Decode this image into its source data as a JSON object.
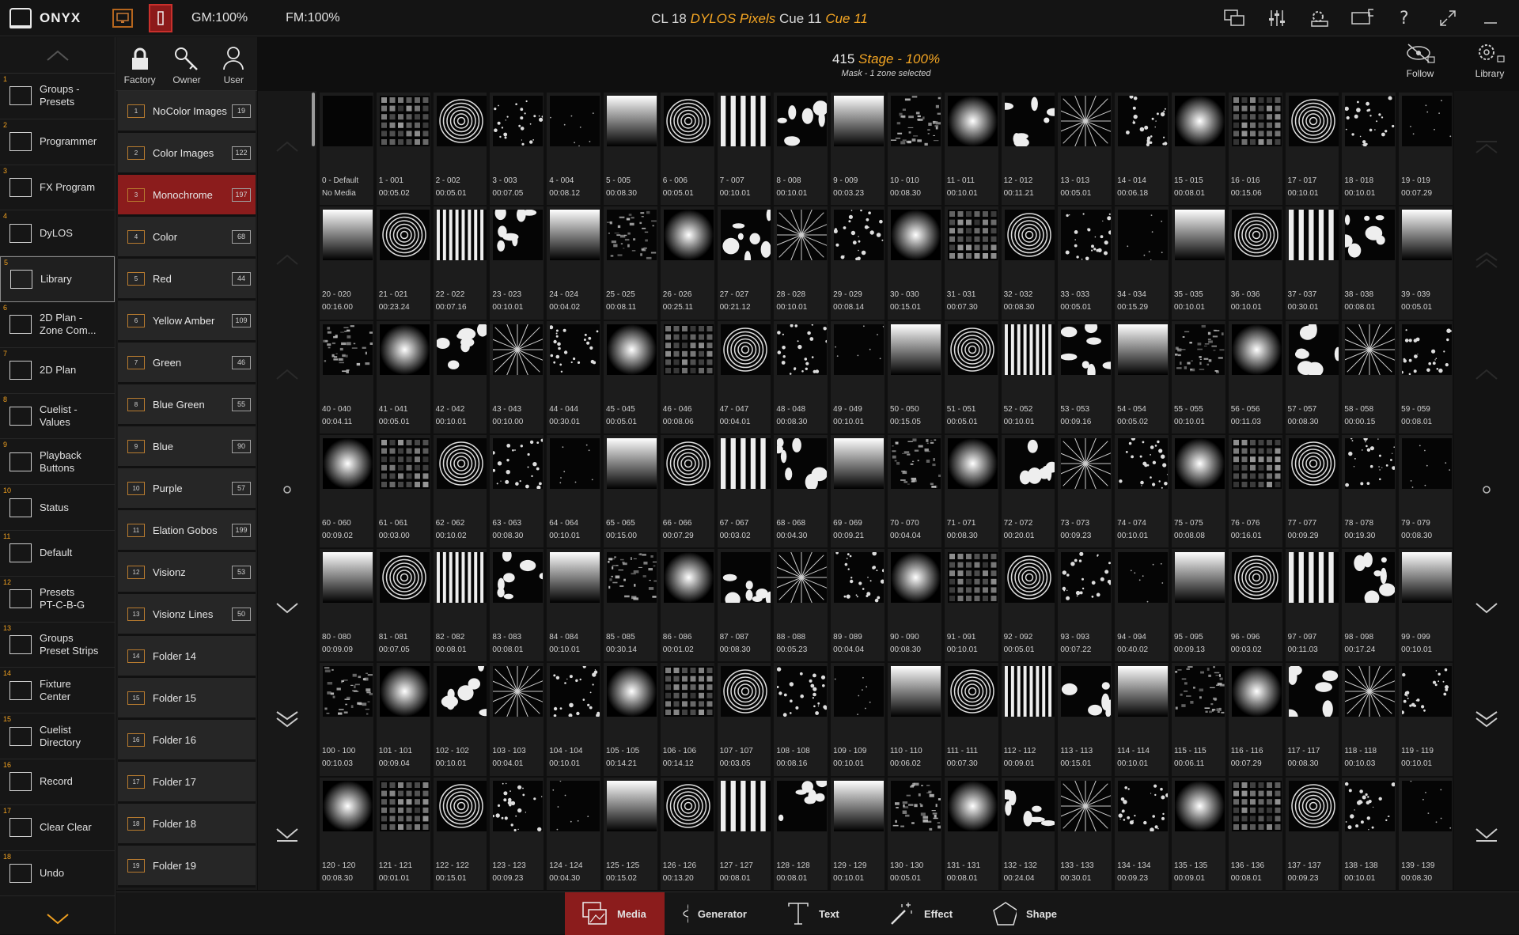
{
  "topbar": {
    "app_name": "ONYX",
    "gm": "GM:100%",
    "fm": "FM:100%",
    "cue": {
      "cl": "CL 18",
      "name": "DYLOS Pixels",
      "cue_label": "Cue 11",
      "cue_name": "Cue 11"
    }
  },
  "leftnav": [
    {
      "num": "1",
      "label": "Groups -\nPresets",
      "icon": "groups-icon"
    },
    {
      "num": "2",
      "label": "Programmer",
      "icon": "programmer-icon"
    },
    {
      "num": "3",
      "label": "FX Program",
      "icon": "fx-icon"
    },
    {
      "num": "4",
      "label": "DyLOS",
      "icon": "dylos-icon"
    },
    {
      "num": "5",
      "label": "Library",
      "icon": "library-icon",
      "active": true
    },
    {
      "num": "6",
      "label": "2D Plan -\nZone Com...",
      "icon": "plan-icon"
    },
    {
      "num": "7",
      "label": "2D Plan",
      "icon": "plan-icon"
    },
    {
      "num": "8",
      "label": "Cuelist -\nValues",
      "icon": "cuelist-icon"
    },
    {
      "num": "9",
      "label": "Playback\nButtons",
      "icon": "playback-icon"
    },
    {
      "num": "10",
      "label": "Status",
      "icon": "status-icon"
    },
    {
      "num": "11",
      "label": "Default",
      "icon": "default-icon"
    },
    {
      "num": "12",
      "label": "Presets\nPT-C-B-G",
      "icon": "presets-icon"
    },
    {
      "num": "13",
      "label": "Groups\nPreset Strips",
      "icon": "groups-icon"
    },
    {
      "num": "14",
      "label": "Fixture\nCenter",
      "icon": "fixture-icon"
    },
    {
      "num": "15",
      "label": "Cuelist\nDirectory",
      "icon": "cuelist-icon"
    },
    {
      "num": "16",
      "label": "Record",
      "icon": "record-icon"
    },
    {
      "num": "17",
      "label": "Clear Clear",
      "icon": "clear-icon"
    },
    {
      "num": "18",
      "label": "Undo",
      "icon": "undo-icon"
    }
  ],
  "folder_tabs": [
    "Factory",
    "Owner",
    "User"
  ],
  "folders": [
    {
      "n": "1",
      "label": "NoColor Images",
      "count": "19"
    },
    {
      "n": "2",
      "label": "Color Images",
      "count": "122"
    },
    {
      "n": "3",
      "label": "Monochrome",
      "count": "197",
      "active": true
    },
    {
      "n": "4",
      "label": "Color",
      "count": "68"
    },
    {
      "n": "5",
      "label": "Red",
      "count": "44"
    },
    {
      "n": "6",
      "label": "Yellow Amber",
      "count": "109"
    },
    {
      "n": "7",
      "label": "Green",
      "count": "46"
    },
    {
      "n": "8",
      "label": "Blue Green",
      "count": "55"
    },
    {
      "n": "9",
      "label": "Blue",
      "count": "90"
    },
    {
      "n": "10",
      "label": "Purple",
      "count": "57"
    },
    {
      "n": "11",
      "label": "Elation Gobos",
      "count": "199"
    },
    {
      "n": "12",
      "label": "Visionz",
      "count": "53"
    },
    {
      "n": "13",
      "label": "Visionz Lines",
      "count": "50"
    },
    {
      "n": "14",
      "label": "Folder 14",
      "count": ""
    },
    {
      "n": "15",
      "label": "Folder 15",
      "count": ""
    },
    {
      "n": "16",
      "label": "Folder 16",
      "count": ""
    },
    {
      "n": "17",
      "label": "Folder 17",
      "count": ""
    },
    {
      "n": "18",
      "label": "Folder 18",
      "count": ""
    },
    {
      "n": "19",
      "label": "Folder 19",
      "count": ""
    }
  ],
  "header": {
    "stage_num": "415",
    "stage_name": "Stage - 100%",
    "subtitle": "Mask - 1 zone selected",
    "follow_label": "Follow",
    "library_label": "Library"
  },
  "media": [
    [
      "0 - Default",
      "No Media"
    ],
    [
      "1 - 001",
      "00:05.02"
    ],
    [
      "2 - 002",
      "00:05.01"
    ],
    [
      "3 - 003",
      "00:07.05"
    ],
    [
      "4 - 004",
      "00:08.12"
    ],
    [
      "5 - 005",
      "00:08.30"
    ],
    [
      "6 - 006",
      "00:05.01"
    ],
    [
      "7 - 007",
      "00:10.01"
    ],
    [
      "8 - 008",
      "00:10.01"
    ],
    [
      "9 - 009",
      "00:03.23"
    ],
    [
      "10 - 010",
      "00:08.30"
    ],
    [
      "11 - 011",
      "00:10.01"
    ],
    [
      "12 - 012",
      "00:11.21"
    ],
    [
      "13 - 013",
      "00:05.01"
    ],
    [
      "14 - 014",
      "00:06.18"
    ],
    [
      "15 - 015",
      "00:08.01"
    ],
    [
      "16 - 016",
      "00:15.06"
    ],
    [
      "17 - 017",
      "00:10.01"
    ],
    [
      "18 - 018",
      "00:10.01"
    ],
    [
      "19 - 019",
      "00:07.29"
    ],
    [
      "20 - 020",
      "00:16.00"
    ],
    [
      "21 - 021",
      "00:23.24"
    ],
    [
      "22 - 022",
      "00:07.16"
    ],
    [
      "23 - 023",
      "00:10.01"
    ],
    [
      "24 - 024",
      "00:04.02"
    ],
    [
      "25 - 025",
      "00:08.11"
    ],
    [
      "26 - 026",
      "00:25.11"
    ],
    [
      "27 - 027",
      "00:21.12"
    ],
    [
      "28 - 028",
      "00:10.01"
    ],
    [
      "29 - 029",
      "00:08.14"
    ],
    [
      "30 - 030",
      "00:15.01"
    ],
    [
      "31 - 031",
      "00:07.30"
    ],
    [
      "32 - 032",
      "00:08.30"
    ],
    [
      "33 - 033",
      "00:05.01"
    ],
    [
      "34 - 034",
      "00:15.29"
    ],
    [
      "35 - 035",
      "00:10.01"
    ],
    [
      "36 - 036",
      "00:10.01"
    ],
    [
      "37 - 037",
      "00:30.01"
    ],
    [
      "38 - 038",
      "00:08.01"
    ],
    [
      "39 - 039",
      "00:05.01"
    ],
    [
      "40 - 040",
      "00:04.11"
    ],
    [
      "41 - 041",
      "00:05.01"
    ],
    [
      "42 - 042",
      "00:10.01"
    ],
    [
      "43 - 043",
      "00:10.00"
    ],
    [
      "44 - 044",
      "00:30.01"
    ],
    [
      "45 - 045",
      "00:05.01"
    ],
    [
      "46 - 046",
      "00:08.06"
    ],
    [
      "47 - 047",
      "00:04.01"
    ],
    [
      "48 - 048",
      "00:08.30"
    ],
    [
      "49 - 049",
      "00:10.01"
    ],
    [
      "50 - 050",
      "00:15.05"
    ],
    [
      "51 - 051",
      "00:05.01"
    ],
    [
      "52 - 052",
      "00:10.01"
    ],
    [
      "53 - 053",
      "00:09.16"
    ],
    [
      "54 - 054",
      "00:05.02"
    ],
    [
      "55 - 055",
      "00:10.01"
    ],
    [
      "56 - 056",
      "00:11.03"
    ],
    [
      "57 - 057",
      "00:08.30"
    ],
    [
      "58 - 058",
      "00:00.15"
    ],
    [
      "59 - 059",
      "00:08.01"
    ],
    [
      "60 - 060",
      "00:09.02"
    ],
    [
      "61 - 061",
      "00:03.00"
    ],
    [
      "62 - 062",
      "00:10.02"
    ],
    [
      "63 - 063",
      "00:08.30"
    ],
    [
      "64 - 064",
      "00:10.01"
    ],
    [
      "65 - 065",
      "00:15.00"
    ],
    [
      "66 - 066",
      "00:07.29"
    ],
    [
      "67 - 067",
      "00:03.02"
    ],
    [
      "68 - 068",
      "00:04.30"
    ],
    [
      "69 - 069",
      "00:09.21"
    ],
    [
      "70 - 070",
      "00:04.04"
    ],
    [
      "71 - 071",
      "00:08.30"
    ],
    [
      "72 - 072",
      "00:20.01"
    ],
    [
      "73 - 073",
      "00:09.23"
    ],
    [
      "74 - 074",
      "00:10.01"
    ],
    [
      "75 - 075",
      "00:08.08"
    ],
    [
      "76 - 076",
      "00:16.01"
    ],
    [
      "77 - 077",
      "00:09.29"
    ],
    [
      "78 - 078",
      "00:19.30"
    ],
    [
      "79 - 079",
      "00:08.30"
    ],
    [
      "80 - 080",
      "00:09.09"
    ],
    [
      "81 - 081",
      "00:07.05"
    ],
    [
      "82 - 082",
      "00:08.01"
    ],
    [
      "83 - 083",
      "00:08.01"
    ],
    [
      "84 - 084",
      "00:10.01"
    ],
    [
      "85 - 085",
      "00:30.14"
    ],
    [
      "86 - 086",
      "00:01.02"
    ],
    [
      "87 - 087",
      "00:08.30"
    ],
    [
      "88 - 088",
      "00:05.23"
    ],
    [
      "89 - 089",
      "00:04.04"
    ],
    [
      "90 - 090",
      "00:08.30"
    ],
    [
      "91 - 091",
      "00:10.01"
    ],
    [
      "92 - 092",
      "00:05.01"
    ],
    [
      "93 - 093",
      "00:07.22"
    ],
    [
      "94 - 094",
      "00:40.02"
    ],
    [
      "95 - 095",
      "00:09.13"
    ],
    [
      "96 - 096",
      "00:03.02"
    ],
    [
      "97 - 097",
      "00:11.03"
    ],
    [
      "98 - 098",
      "00:17.24"
    ],
    [
      "99 - 099",
      "00:10.01"
    ],
    [
      "100 - 100",
      "00:10.03"
    ],
    [
      "101 - 101",
      "00:09.04"
    ],
    [
      "102 - 102",
      "00:10.01"
    ],
    [
      "103 - 103",
      "00:04.01"
    ],
    [
      "104 - 104",
      "00:10.01"
    ],
    [
      "105 - 105",
      "00:14.21"
    ],
    [
      "106 - 106",
      "00:14.12"
    ],
    [
      "107 - 107",
      "00:03.05"
    ],
    [
      "108 - 108",
      "00:08.16"
    ],
    [
      "109 - 109",
      "00:10.01"
    ],
    [
      "110 - 110",
      "00:06.02"
    ],
    [
      "111 - 111",
      "00:07.30"
    ],
    [
      "112 - 112",
      "00:09.01"
    ],
    [
      "113 - 113",
      "00:15.01"
    ],
    [
      "114 - 114",
      "00:10.01"
    ],
    [
      "115 - 115",
      "00:06.11"
    ],
    [
      "116 - 116",
      "00:07.29"
    ],
    [
      "117 - 117",
      "00:08.30"
    ],
    [
      "118 - 118",
      "00:10.03"
    ],
    [
      "119 - 119",
      "00:10.01"
    ],
    [
      "120 - 120",
      "00:08.30"
    ],
    [
      "121 - 121",
      "00:01.01"
    ],
    [
      "122 - 122",
      "00:15.01"
    ],
    [
      "123 - 123",
      "00:09.23"
    ],
    [
      "124 - 124",
      "00:04.30"
    ],
    [
      "125 - 125",
      "00:15.02"
    ],
    [
      "126 - 126",
      "00:13.20"
    ],
    [
      "127 - 127",
      "00:08.01"
    ],
    [
      "128 - 128",
      "00:08.01"
    ],
    [
      "129 - 129",
      "00:10.01"
    ],
    [
      "130 - 130",
      "00:05.01"
    ],
    [
      "131 - 131",
      "00:08.01"
    ],
    [
      "132 - 132",
      "00:24.04"
    ],
    [
      "133 - 133",
      "00:30.01"
    ],
    [
      "134 - 134",
      "00:09.23"
    ],
    [
      "135 - 135",
      "00:09.01"
    ],
    [
      "136 - 136",
      "00:08.01"
    ],
    [
      "137 - 137",
      "00:09.23"
    ],
    [
      "138 - 138",
      "00:10.01"
    ],
    [
      "139 - 139",
      "00:08.30"
    ]
  ],
  "bottom_tabs": [
    {
      "label": "Media",
      "icon": "media-icon",
      "active": true
    },
    {
      "label": "Generator",
      "icon": "generator-icon"
    },
    {
      "label": "Text",
      "icon": "text-icon"
    },
    {
      "label": "Effect",
      "icon": "effect-icon"
    },
    {
      "label": "Shape",
      "icon": "shape-icon"
    }
  ],
  "colors": {
    "accent": "#f5a623",
    "active": "#8b1c1c",
    "folder_icon": "#b87b2f"
  }
}
